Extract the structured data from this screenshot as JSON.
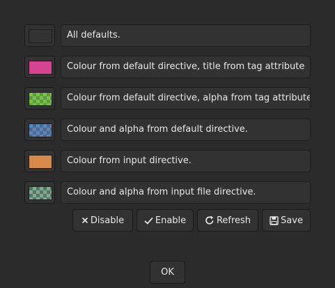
{
  "rows": [
    {
      "label": "All defaults.",
      "swatch": {
        "color": "#333333",
        "checker": false
      }
    },
    {
      "label": "Colour from default directive, title from tag attribute",
      "swatch": {
        "color": "#d64491",
        "checker": false
      }
    },
    {
      "label": "Colour from default directive, alpha from tag attribute",
      "swatch": {
        "color": "#77c34a",
        "checker": true,
        "checker_alt": "#5f9a3e"
      }
    },
    {
      "label": "Colour and alpha from default directive.",
      "swatch": {
        "color": "#5f86b8",
        "checker": true,
        "checker_alt": "#4a6a92"
      }
    },
    {
      "label": "Colour from input directive.",
      "swatch": {
        "color": "#d88a48",
        "checker": false
      }
    },
    {
      "label": "Colour and alpha from input file directive.",
      "swatch": {
        "color": "#4f7a62",
        "checker": true,
        "checker_alt": "#8aa594"
      }
    }
  ],
  "buttons": {
    "disable": {
      "label": "Disable",
      "icon": "close-icon"
    },
    "enable": {
      "label": "Enable",
      "icon": "checkmark-icon"
    },
    "refresh": {
      "label": "Refresh",
      "icon": "refresh-icon"
    },
    "save": {
      "label": "Save",
      "icon": "save-icon"
    }
  },
  "ok_label": "OK"
}
